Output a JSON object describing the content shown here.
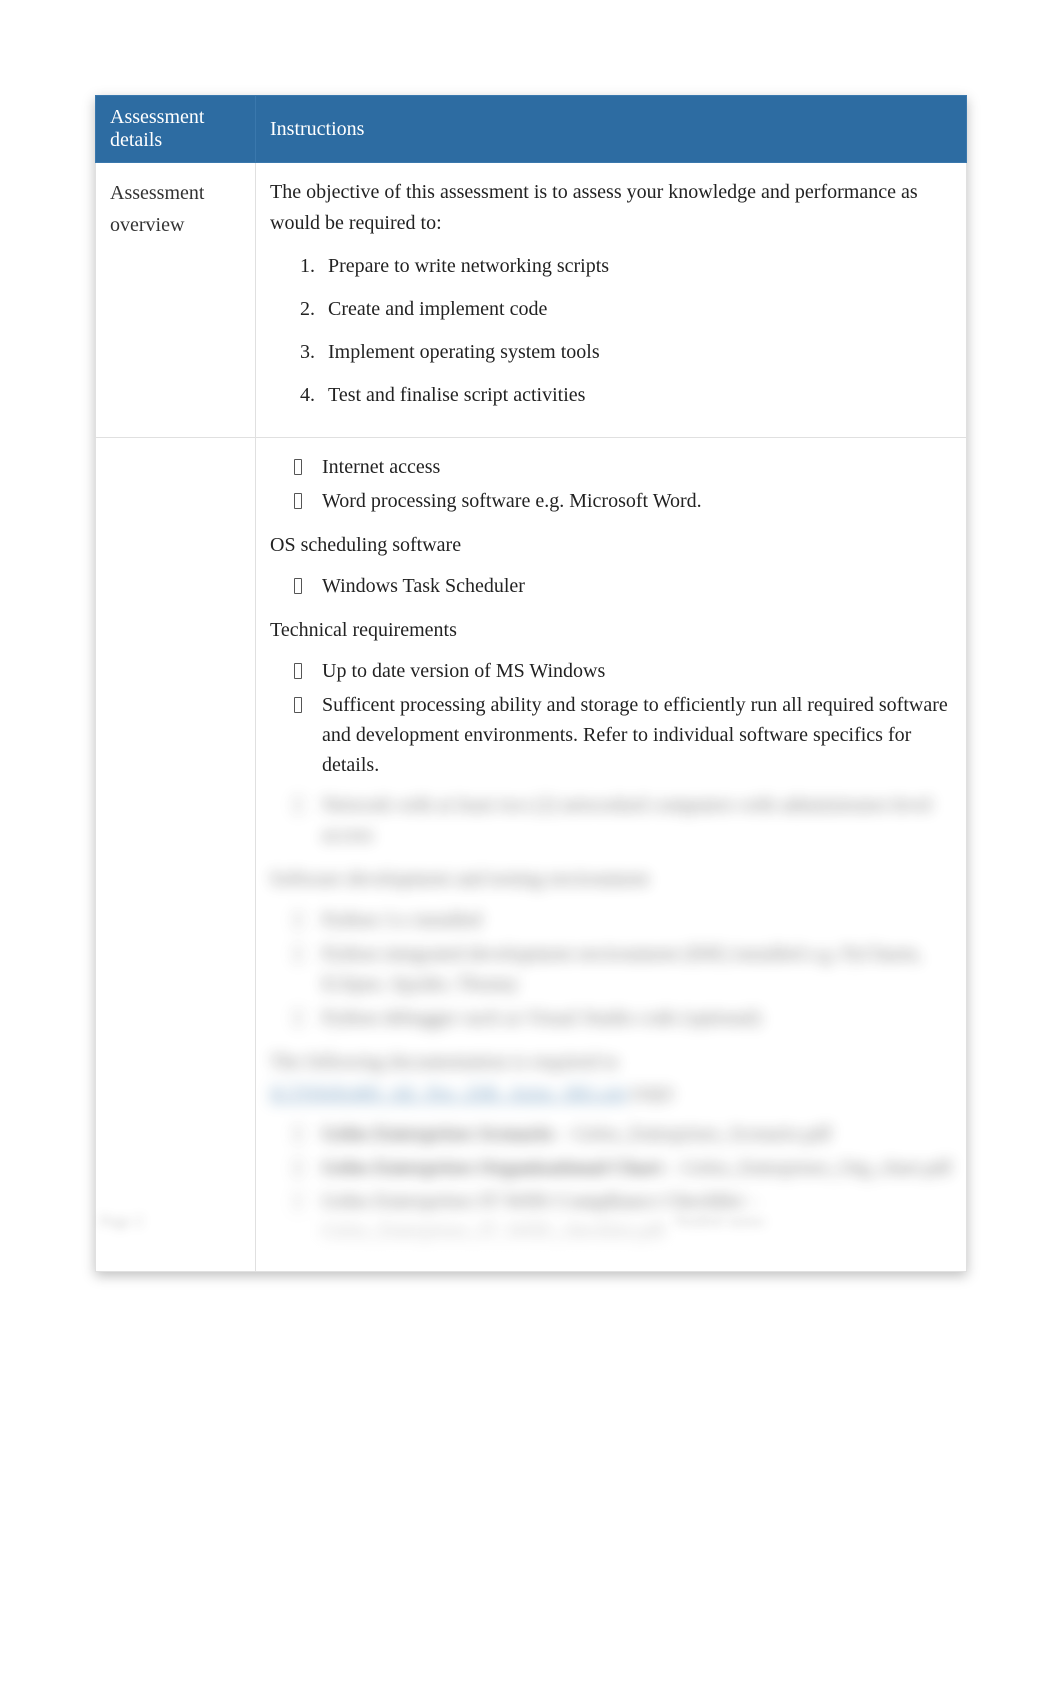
{
  "header": {
    "col1": "Assessment details",
    "col2": "Instructions"
  },
  "overview": {
    "label": "Assessment overview",
    "intro": "The objective of this assessment is to assess your knowledge and performance as would be required to:",
    "items": [
      "Prepare to write networking scripts",
      "Create and implement code",
      "Implement operating system tools",
      "Test and finalise script activities"
    ]
  },
  "resources": {
    "top_bullets": [
      "Internet access",
      "Word processing software e.g. Microsoft Word."
    ],
    "scheduling_heading": "OS scheduling software",
    "scheduling_items": [
      "Windows Task Scheduler"
    ],
    "technical_heading": "Technical requirements",
    "technical_items": [
      "Up to date version of MS Windows",
      "Sufficent processing ability and storage to efficiently run all required software and development environments. Refer to individual software specifics for details."
    ],
    "blurred": {
      "bullet1": "Network with at least two (2) networked computers with administrator-level access",
      "heading1": "Software development and testing environment",
      "bullet2": "Python 3.x installed",
      "bullet3": "Python integrated development environment (IDE) installed e.g. PyCharm, Eclipse, Spyder, Thonny",
      "bullet4": "Python debugger such as Visual Studio code (optional)",
      "para1": "The following documentation is required to",
      "link": "ICTNWK409_AE_Pro_2SR_Appx_SR1.zip",
      "para1_suffix": " (zip):",
      "file1_bold": "Gelos Enterprises Scenario",
      "file1_rest": " – Gelos_Enterprises_Scenario.pdf",
      "file2_bold": "Gelos Enterprises Organisational Chart",
      "file2_rest": " – Gelos_Enterprises_Org_chart.pdf",
      "file3_bold": "Gelos Enterprises IT WHS Compliance Checklist",
      "file3_rest": " – Gelos_Enterprises_IT_WHS_checklist.pdf"
    }
  },
  "footer": {
    "left": "Page 2",
    "right": "Student name:"
  }
}
